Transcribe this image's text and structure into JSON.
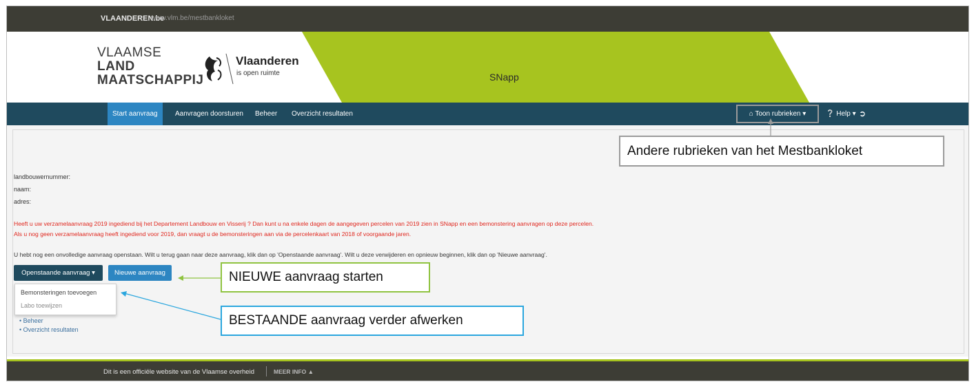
{
  "topbar": {
    "brand": "VLAANDEREN.be",
    "url": "www.vlm.be/mestbankloket"
  },
  "header": {
    "vlm_line1": "VLAAMSE",
    "vlm_line2": "LAND",
    "vlm_line3": "MAATSCHAPPIJ",
    "vlaanderen_name": "Vlaanderen",
    "vlaanderen_tagline": "is open ruimte",
    "app_name": "SNapp"
  },
  "nav": {
    "items": [
      "Start aanvraag",
      "Aanvragen doorsturen",
      "Beheer",
      "Overzicht resultaten"
    ],
    "rubrieken": "Toon rubrieken",
    "help": "Help"
  },
  "fields": [
    "landbouwernummer:",
    "naam:",
    "adres:"
  ],
  "notice": [
    "Heeft u uw verzamelaanvraag 2019 ingediend bij het Departement Landbouw en Visserij ? Dan kunt u na enkele dagen de aangegeven percelen van 2019 zien in SNapp en een bemonstering aanvragen op deze percelen.",
    "Als u nog geen verzamelaanvraag heeft ingediend voor 2019, dan vraagt u de bemonsteringen aan via de percelenkaart van 2018 of voorgaande jaren."
  ],
  "info": "U hebt nog een onvolledige aanvraag openstaan. Wilt u terug gaan naar deze aanvraag, klik dan op 'Openstaande aanvraag'. Wilt u deze verwijderen en opnieuw beginnen, klik dan op 'Nieuwe aanvraag'.",
  "buttons": {
    "open": "Openstaande aanvraag",
    "new": "Nieuwe aanvraag"
  },
  "dropdown": [
    "Bemonsteringen toevoegen",
    "Labo toewijzen"
  ],
  "links": [
    "Beheer",
    "Overzicht resultaten"
  ],
  "callouts": {
    "rubrieken": "Andere rubrieken van het Mestbankloket",
    "nieuwe": "NIEUWE aanvraag starten",
    "bestaande": "BESTAANDE aanvraag verder afwerken"
  },
  "footer": {
    "text": "Dit is een officiële website van de Vlaamse overheid",
    "more": "MEER INFO"
  },
  "colors": {
    "nav": "#1f4a5e",
    "active": "#2d86c2",
    "green": "#a7c41f",
    "dark": "#3d3d35",
    "red": "#e0261d"
  }
}
